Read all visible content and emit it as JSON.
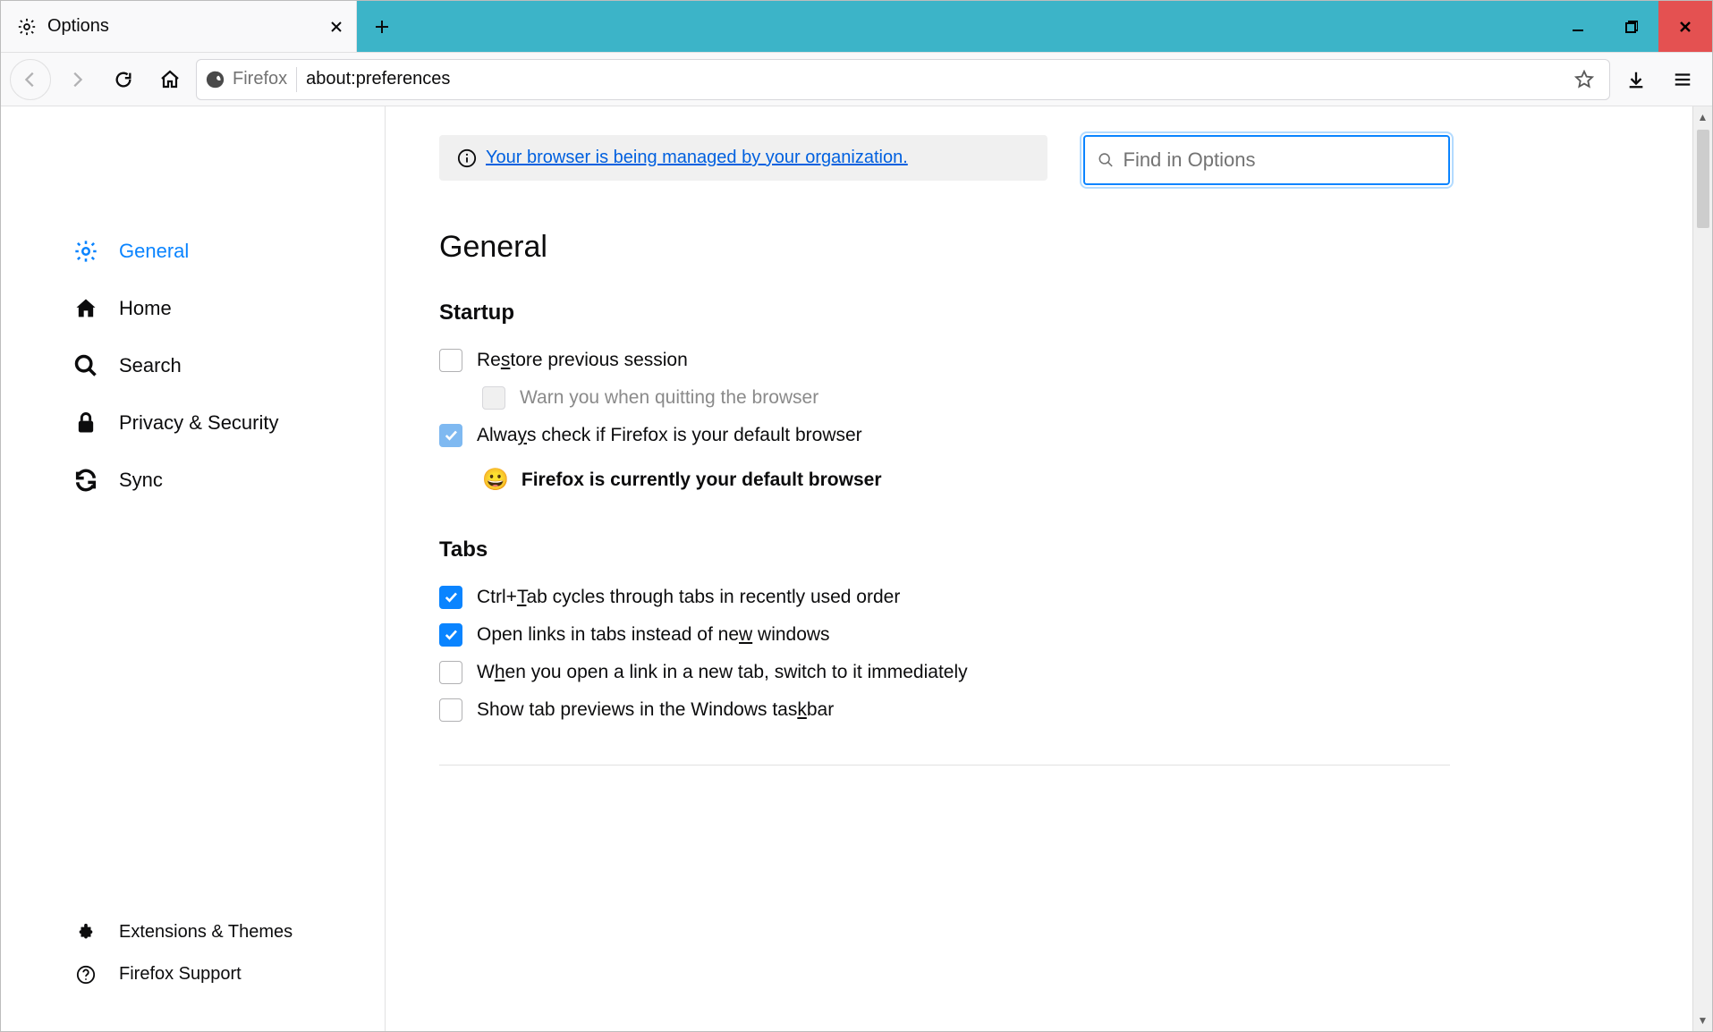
{
  "tab": {
    "title": "Options"
  },
  "urlbar": {
    "identity": "Firefox",
    "url": "about:preferences"
  },
  "banner": {
    "text": "Your browser is being managed by your organization."
  },
  "search": {
    "placeholder": "Find in Options"
  },
  "sidebar": {
    "items": [
      {
        "label": "General"
      },
      {
        "label": "Home"
      },
      {
        "label": "Search"
      },
      {
        "label": "Privacy & Security"
      },
      {
        "label": "Sync"
      }
    ],
    "footer": [
      {
        "label": "Extensions & Themes"
      },
      {
        "label": "Firefox Support"
      }
    ]
  },
  "headings": {
    "page": "General",
    "startup": "Startup",
    "tabs": "Tabs"
  },
  "startup": {
    "restore_pre": "Re",
    "restore_key": "s",
    "restore_post": "tore previous session",
    "warn": "Warn you when quitting the browser",
    "check_pre": "Alwa",
    "check_key": "y",
    "check_post": "s check if Firefox is your default browser",
    "default_status": "Firefox is currently your default browser"
  },
  "tabs": {
    "ctrl_pre": "Ctrl+",
    "ctrl_key": "T",
    "ctrl_post": "ab cycles through tabs in recently used order",
    "links_pre": "Open links in tabs instead of ne",
    "links_key": "w",
    "links_post": " windows",
    "switch_pre": "W",
    "switch_key": "h",
    "switch_post": "en you open a link in a new tab, switch to it immediately",
    "taskbar_pre": "Show tab previews in the Windows tas",
    "taskbar_key": "k",
    "taskbar_post": "bar"
  }
}
